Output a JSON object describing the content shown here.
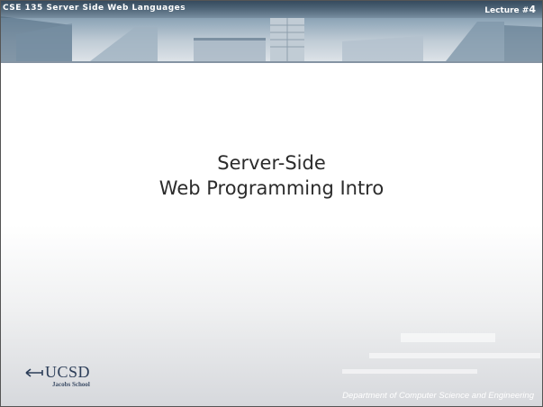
{
  "header": {
    "course_label": "CSE 135   Server Side Web Languages",
    "lecture_label": "Lecture #",
    "lecture_number": "4"
  },
  "slide": {
    "title_line1": "Server-Side",
    "title_line2": "Web Programming Intro"
  },
  "footer": {
    "logo_wordmark": "UCSD",
    "logo_school": "Jacobs School",
    "department": "Department of Computer Science and Engineering"
  },
  "icons": {
    "logo_mark": "ucsd-triton-mark-icon"
  },
  "colors": {
    "banner": "#6f879c",
    "title_text": "#2b2b2b",
    "logo": "#2c3d58"
  }
}
